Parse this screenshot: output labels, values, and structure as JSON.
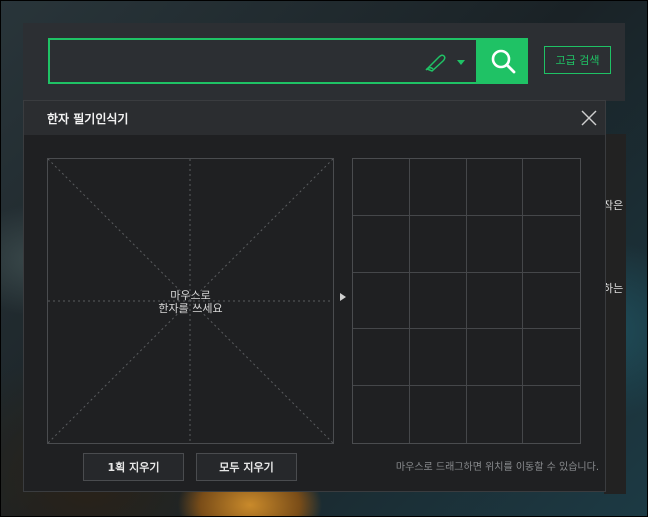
{
  "search": {
    "value": "",
    "placeholder": ""
  },
  "advanced_search_label": "고급 검색",
  "handwriting_panel": {
    "title": "한자 필기인식기",
    "canvas_hint_line1": "마우스로",
    "canvas_hint_line2": "한자를 쓰세요",
    "clear_stroke_label": "1획 지우기",
    "clear_all_label": "모두 지우기",
    "drag_hint": "마우스로 드래그하면 위치를 이동할 수 있습니다."
  },
  "side_texts": [
    "작은",
    "하는"
  ],
  "colors": {
    "accent": "#1fc265",
    "panel_bg": "#1f2022",
    "header_bg": "#2b2d30"
  },
  "icons": {
    "handwrite": "pen-icon",
    "search": "search-icon",
    "close": "close-icon"
  }
}
